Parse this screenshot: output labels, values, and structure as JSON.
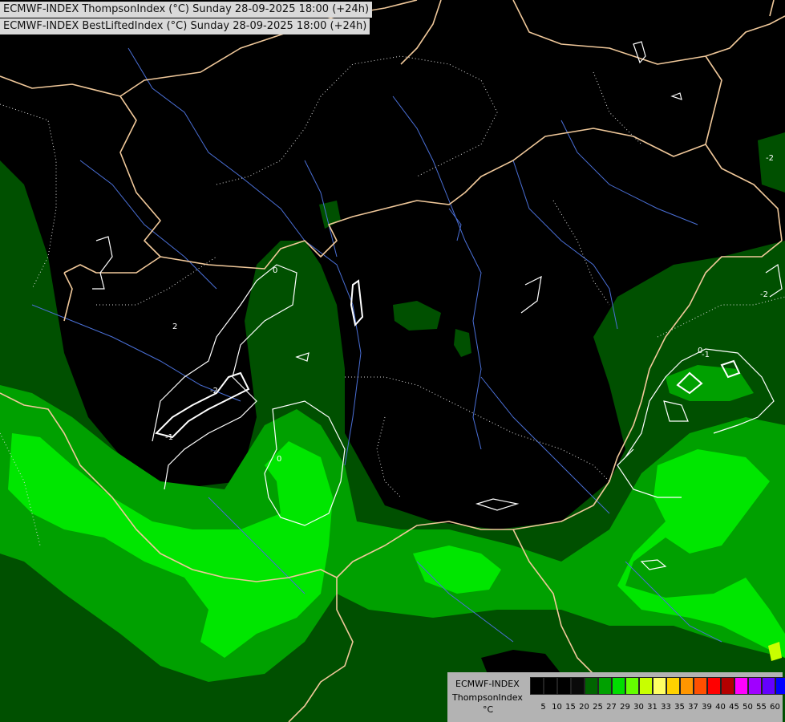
{
  "header": {
    "line1": "ECMWF-INDEX ThompsonIndex (°C) Sunday 28-09-2025 18:00 (+24h)",
    "line2": "ECMWF-INDEX BestLiftedIndex (°C) Sunday 28-09-2025 18:00 (+24h)"
  },
  "legend": {
    "model": "ECMWF-INDEX",
    "parameter": "ThompsonIndex",
    "unit": "°C",
    "thresholds": [
      "5",
      "10",
      "15",
      "20",
      "25",
      "27",
      "29",
      "30",
      "31",
      "33",
      "35",
      "37",
      "39",
      "40",
      "45",
      "50",
      "55",
      "60"
    ],
    "colors": [
      "#000000",
      "#000000",
      "#000000",
      "#0a0a0a",
      "#006400",
      "#00a000",
      "#00dc00",
      "#64ff00",
      "#c8ff00",
      "#ffff64",
      "#ffd200",
      "#ff9600",
      "#ff5000",
      "#ff0000",
      "#b40000",
      "#ff00ff",
      "#a000ff",
      "#6400ff",
      "#0000ff"
    ]
  },
  "contour_labels": [
    "2",
    "-2",
    "-1",
    "-1",
    "0",
    "0",
    "0",
    "-2",
    "-2"
  ],
  "colors": {
    "background": "#000000",
    "dark_green": "#005a00",
    "mid_green": "#00b400",
    "bright_green": "#00f000",
    "border": "#f0c89a",
    "river": "#4a6fd6",
    "contour": "#ffffff"
  }
}
